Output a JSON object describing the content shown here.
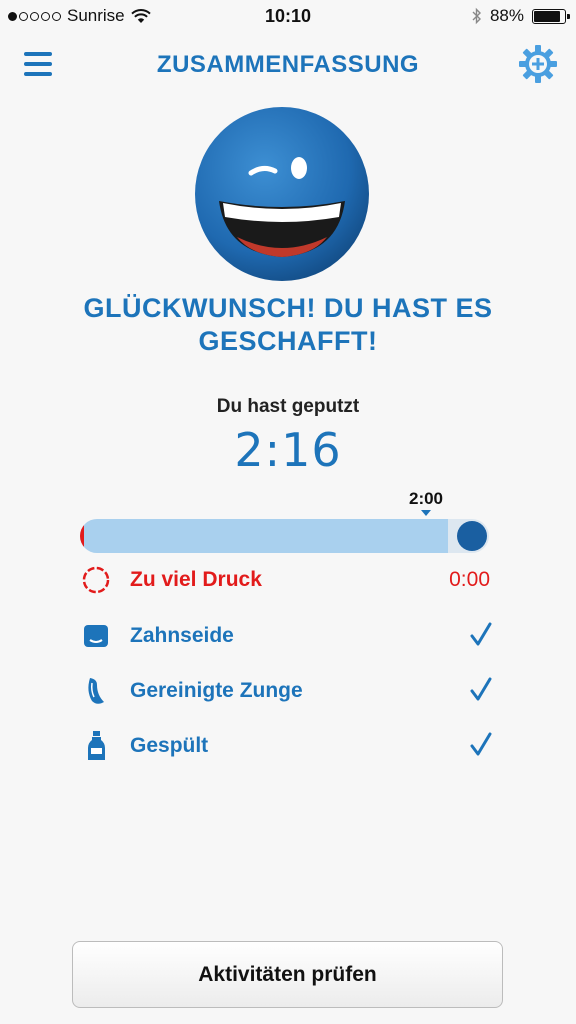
{
  "status_bar": {
    "carrier": "Sunrise",
    "time": "10:10",
    "battery": "88%",
    "battery_level": 0.88,
    "signal_bars_filled": 1,
    "signal_bars_total": 5
  },
  "header": {
    "title": "ZUSAMMENFASSUNG",
    "menu_icon": "hamburger-menu-icon",
    "settings_icon": "gear-plus-icon"
  },
  "summary": {
    "mascot_icon": "winking-smiley-icon",
    "congrats_line1": "GLÜCKWUNSCH! DU HAST ES",
    "congrats_line2": "GESCHAFFT!",
    "brushed_label": "Du hast geputzt",
    "brushed_time": "2:16",
    "target_label": "2:00",
    "progress": {
      "brushed_seconds": 136,
      "target_seconds": 120,
      "fill_fraction": 0.9
    }
  },
  "activities": [
    {
      "name": "pressure",
      "label": "Zu viel Druck",
      "value": "0:00",
      "icon": "pressure-ring-icon",
      "color": "#e21b1b"
    },
    {
      "name": "floss",
      "label": "Zahnseide",
      "icon": "floss-icon",
      "checked": true
    },
    {
      "name": "tongue",
      "label": "Gereinigte Zunge",
      "icon": "tongue-icon",
      "checked": true
    },
    {
      "name": "rinse",
      "label": "Gespült",
      "icon": "mouthwash-bottle-icon",
      "checked": true
    }
  ],
  "footer": {
    "button_label": "Aktivitäten prüfen"
  },
  "colors": {
    "accent": "#1d74ba",
    "warning": "#e21b1b",
    "progress_fill": "#a9d0ee",
    "progress_knob": "#1a5fa1"
  }
}
